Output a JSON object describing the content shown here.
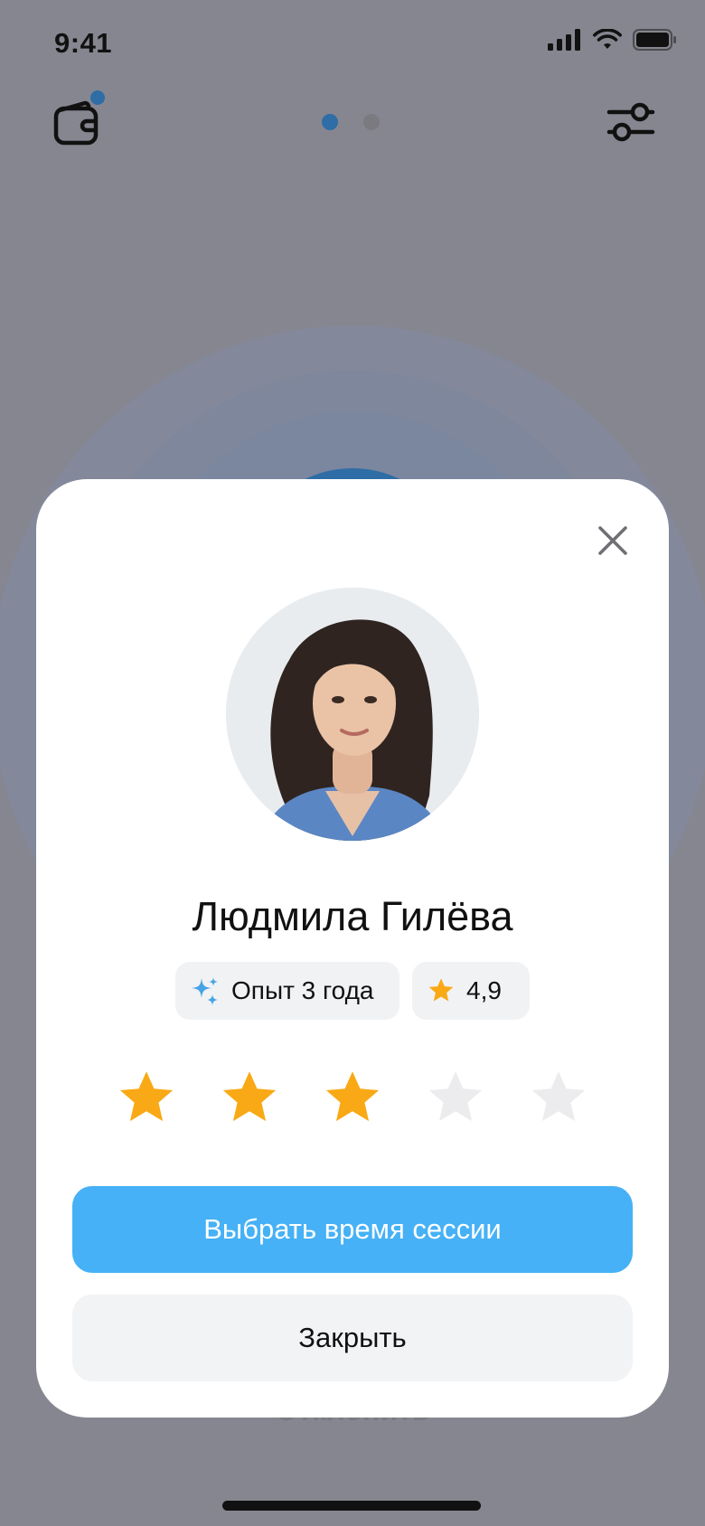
{
  "status_bar": {
    "time": "9:41",
    "icons": [
      "cellular-signal-icon",
      "wifi-icon",
      "battery-icon"
    ]
  },
  "header": {
    "left_icon": "wallet-icon",
    "right_icon": "filters-icon",
    "pager": {
      "total": 2,
      "active_index": 0
    }
  },
  "background": {
    "partial_text": "Отклонить"
  },
  "modal": {
    "close_icon": "close-icon",
    "specialist": {
      "name": "Людмила Гилёва",
      "avatar": "specialist-photo",
      "experience_label": "Опыт 3 года",
      "experience_icon": "sparkles-icon",
      "rating_value": "4,9",
      "rating_icon": "star-icon"
    },
    "user_rating": {
      "value": 3,
      "max": 5
    },
    "primary_button": "Выбрать время сессии",
    "secondary_button": "Закрыть"
  },
  "colors": {
    "accent_blue": "#46b1f6",
    "star_filled": "#f9a915",
    "star_empty": "#ececee",
    "overlay": "#868690",
    "indicator_dark_blue": "#2e6da6"
  }
}
